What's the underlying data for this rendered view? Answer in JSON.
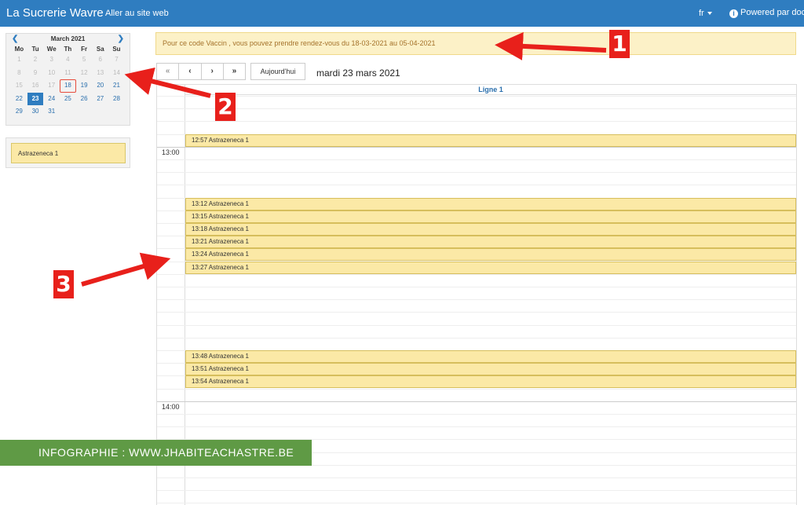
{
  "nav": {
    "brand": "La Sucrerie Wavre",
    "site_link": "Aller au site web",
    "lang": "fr",
    "powered": "Powered par doctena"
  },
  "mini_calendar": {
    "month": "March 2021",
    "weekdays": [
      "Mo",
      "Tu",
      "We",
      "Th",
      "Fr",
      "Sa",
      "Su"
    ],
    "days": [
      {
        "d": "1",
        "s": "past"
      },
      {
        "d": "2",
        "s": "past"
      },
      {
        "d": "3",
        "s": "past"
      },
      {
        "d": "4",
        "s": "past"
      },
      {
        "d": "5",
        "s": "past"
      },
      {
        "d": "6",
        "s": "past"
      },
      {
        "d": "7",
        "s": "past"
      },
      {
        "d": "8",
        "s": "past"
      },
      {
        "d": "9",
        "s": "past"
      },
      {
        "d": "10",
        "s": "past"
      },
      {
        "d": "11",
        "s": "past"
      },
      {
        "d": "12",
        "s": "past"
      },
      {
        "d": "13",
        "s": "past"
      },
      {
        "d": "14",
        "s": "past"
      },
      {
        "d": "15",
        "s": "past"
      },
      {
        "d": "16",
        "s": "past"
      },
      {
        "d": "17",
        "s": "past"
      },
      {
        "d": "18",
        "s": "today"
      },
      {
        "d": "19",
        "s": ""
      },
      {
        "d": "20",
        "s": ""
      },
      {
        "d": "21",
        "s": ""
      },
      {
        "d": "22",
        "s": ""
      },
      {
        "d": "23",
        "s": "selected"
      },
      {
        "d": "24",
        "s": ""
      },
      {
        "d": "25",
        "s": ""
      },
      {
        "d": "26",
        "s": ""
      },
      {
        "d": "27",
        "s": ""
      },
      {
        "d": "28",
        "s": ""
      },
      {
        "d": "29",
        "s": ""
      },
      {
        "d": "30",
        "s": ""
      },
      {
        "d": "31",
        "s": ""
      }
    ]
  },
  "type_panel": {
    "item": "Astrazeneca 1"
  },
  "alert": {
    "text": "Pour ce code Vaccin , vous pouvez prendre rendez-vous du 18-03-2021 au 05-04-2021"
  },
  "toolbar": {
    "first": "«",
    "prev": "‹",
    "next": "›",
    "last": "»",
    "today": "Aujourd'hui",
    "date_title": "mardi 23 mars 2021"
  },
  "schedule": {
    "column": "Ligne 1",
    "hours": [
      "13:00",
      "14:00"
    ],
    "appointments": [
      {
        "time": "12:57",
        "label": "12:57 Astrazeneca 1"
      },
      {
        "time": "13:12",
        "label": "13:12 Astrazeneca 1"
      },
      {
        "time": "13:15",
        "label": "13:15 Astrazeneca 1"
      },
      {
        "time": "13:18",
        "label": "13:18 Astrazeneca 1"
      },
      {
        "time": "13:21",
        "label": "13:21 Astrazeneca 1"
      },
      {
        "time": "13:24",
        "label": "13:24 Astrazeneca 1"
      },
      {
        "time": "13:27",
        "label": "13:27 Astrazeneca 1"
      },
      {
        "time": "13:48",
        "label": "13:48 Astrazeneca 1"
      },
      {
        "time": "13:51",
        "label": "13:51 Astrazeneca 1"
      },
      {
        "time": "13:54",
        "label": "13:54 Astrazeneca 1"
      }
    ]
  },
  "annotations": [
    "1",
    "2",
    "3"
  ],
  "banner": {
    "text": "INFOGRAPHIE : WWW.JHABITEACHASTRE.BE"
  },
  "colors": {
    "nav": "#2f7dc0",
    "appointment": "#fbe9a6",
    "alert_bg": "#fcf1c7",
    "annotation": "#e8201b",
    "banner": "#5f9a45"
  }
}
